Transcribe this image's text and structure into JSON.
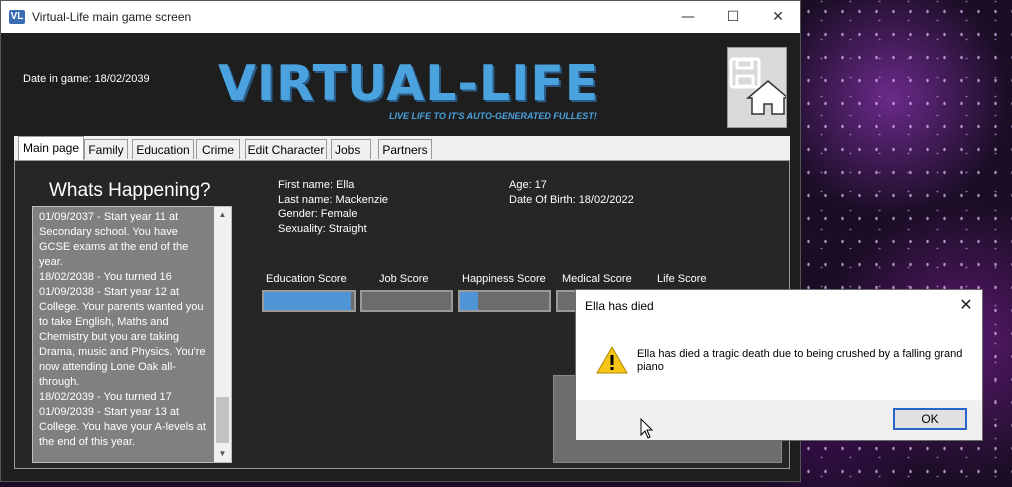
{
  "window": {
    "title": "Virtual-Life main game screen",
    "minimize": "—",
    "maximize": "☐",
    "close": "✕"
  },
  "header": {
    "date_label": "Date in game: 18/02/2039",
    "logo": "VIRTUAL-LIFE",
    "tagline": "LIVE LIFE TO IT'S AUTO-GENERATED FULLEST!"
  },
  "tabs": [
    "Main page",
    "Family",
    "Education",
    "Crime",
    "Edit Character",
    "Jobs",
    "Partners"
  ],
  "happenings": {
    "title": "Whats Happening?",
    "entries": [
      "01/09/2037 - Start year 11 at Secondary school. You have GCSE exams at the end of the year.",
      "18/02/2038 - You turned 16",
      "01/09/2038 - Start year 12 at College. Your parents wanted you to take English, Maths and Chemistry but you are taking Drama, music and Physics. You're now attending Lone Oak all-through.",
      "18/02/2039 - You turned 17",
      "01/09/2039 - Start year 13 at College. You have your A-levels at the end of this year."
    ]
  },
  "character": {
    "first_name": "First name: Ella",
    "last_name": "Last name: Mackenzie",
    "gender": "Gender: Female",
    "sexuality": "Sexuality: Straight",
    "age": "Age: 17",
    "dob": "Date Of Birth: 18/02/2022"
  },
  "scores": {
    "education": {
      "label": "Education Score",
      "value": 0.97
    },
    "job": {
      "label": "Job Score",
      "value": 0
    },
    "happiness": {
      "label": "Happiness Score",
      "value": 0.2
    },
    "medical": {
      "label": "Medical Score"
    },
    "life": {
      "label": "Life Score"
    }
  },
  "dialog": {
    "title": "Ella has died",
    "message": "Ella has died a tragic death due to being crushed by a falling grand piano",
    "ok": "OK",
    "close": "✕"
  },
  "colors": {
    "accent": "#4aa3df",
    "bar_fill": "#4f95d6",
    "panel": "#262626"
  },
  "icons": [
    "app-icon",
    "save-icon",
    "home-icon",
    "warning-icon",
    "cursor-icon"
  ]
}
